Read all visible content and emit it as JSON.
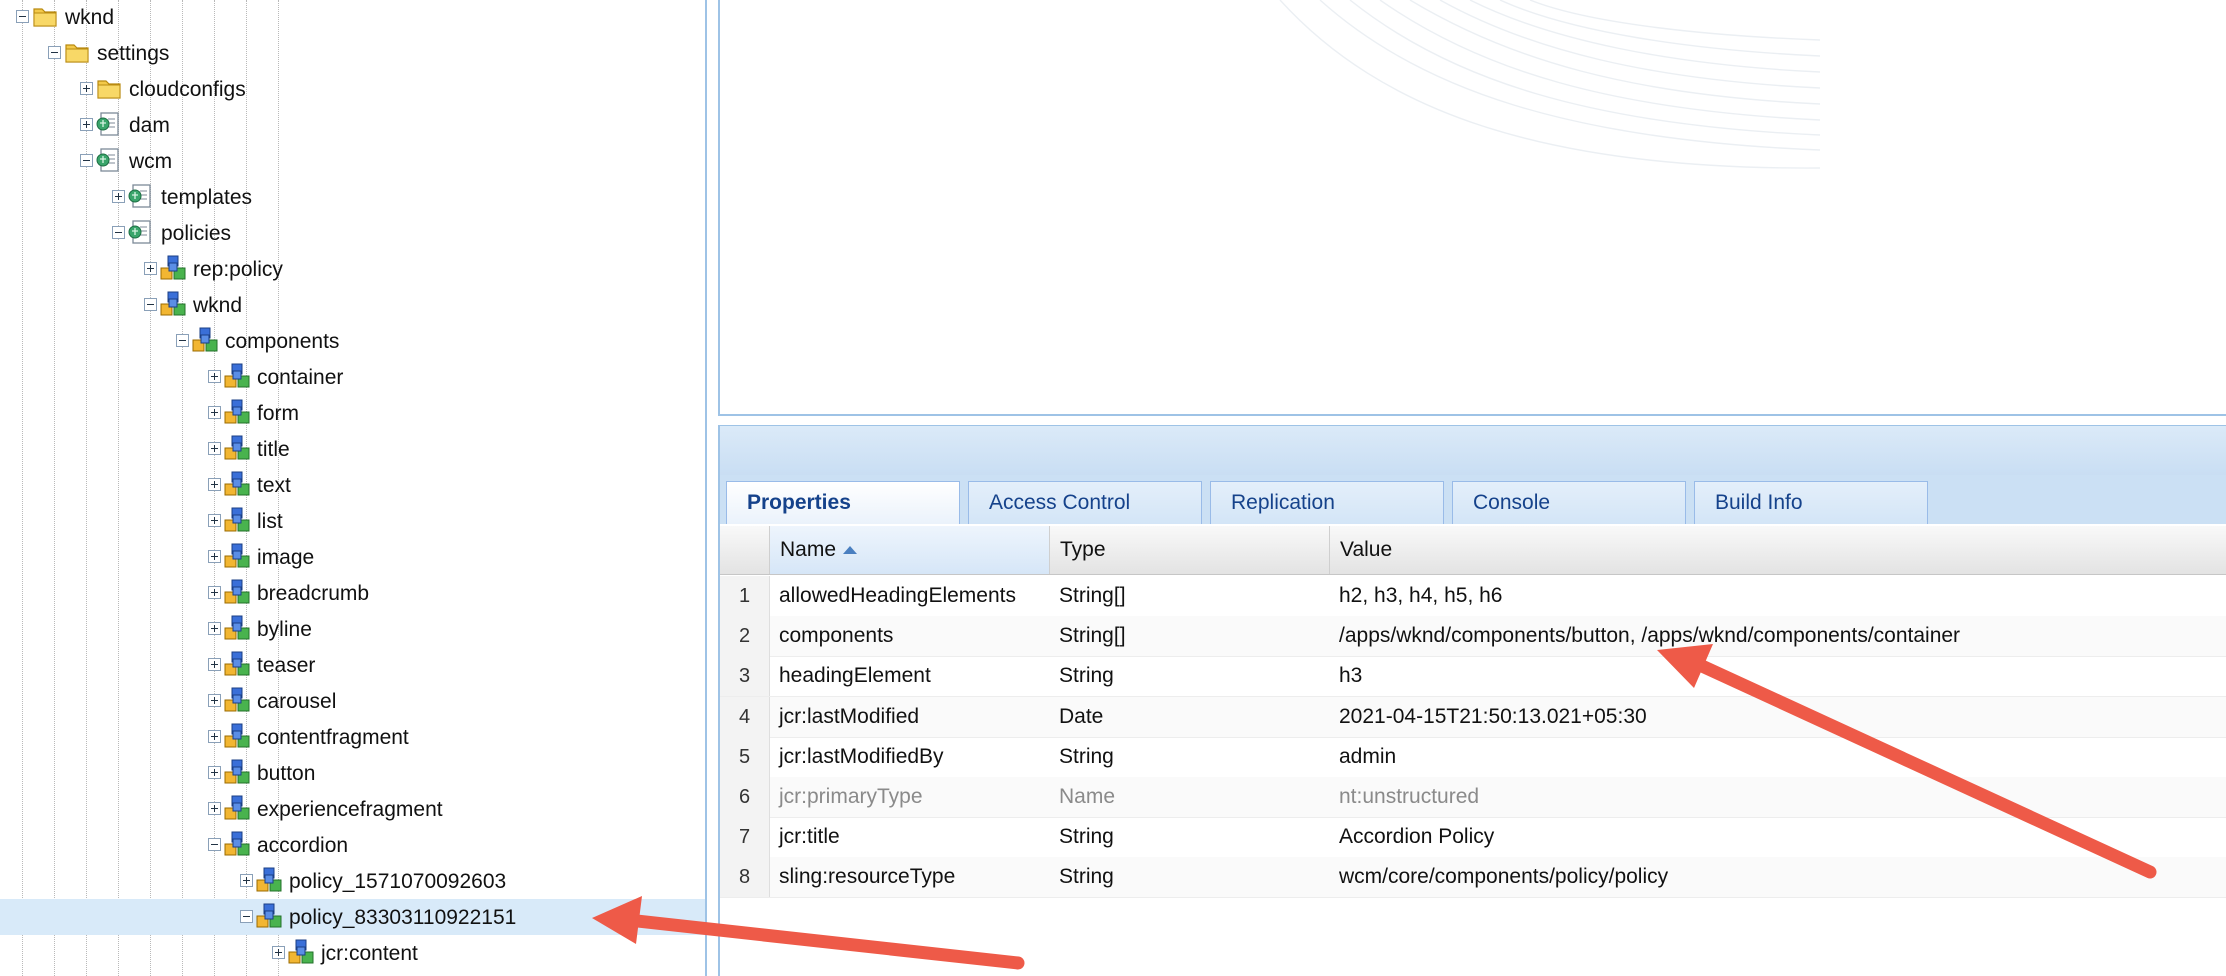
{
  "tree": {
    "nodes": [
      {
        "label": "wknd",
        "icon": "folder-icon",
        "level": 0,
        "expanded": true
      },
      {
        "label": "settings",
        "icon": "folder-icon",
        "level": 1,
        "expanded": true
      },
      {
        "label": "cloudconfigs",
        "icon": "folder-icon",
        "level": 2,
        "expanded": false
      },
      {
        "label": "dam",
        "icon": "page-icon",
        "level": 2,
        "expanded": false
      },
      {
        "label": "wcm",
        "icon": "page-icon",
        "level": 2,
        "expanded": true
      },
      {
        "label": "templates",
        "icon": "page-icon",
        "level": 3,
        "expanded": false
      },
      {
        "label": "policies",
        "icon": "page-icon",
        "level": 3,
        "expanded": true
      },
      {
        "label": "rep:policy",
        "icon": "node-icon",
        "level": 4,
        "expanded": false
      },
      {
        "label": "wknd",
        "icon": "node-icon",
        "level": 4,
        "expanded": true
      },
      {
        "label": "components",
        "icon": "node-icon",
        "level": 5,
        "expanded": true
      },
      {
        "label": "container",
        "icon": "node-icon",
        "level": 6,
        "expanded": false
      },
      {
        "label": "form",
        "icon": "node-icon",
        "level": 6,
        "expanded": false
      },
      {
        "label": "title",
        "icon": "node-icon",
        "level": 6,
        "expanded": false
      },
      {
        "label": "text",
        "icon": "node-icon",
        "level": 6,
        "expanded": false
      },
      {
        "label": "list",
        "icon": "node-icon",
        "level": 6,
        "expanded": false
      },
      {
        "label": "image",
        "icon": "node-icon",
        "level": 6,
        "expanded": false
      },
      {
        "label": "breadcrumb",
        "icon": "node-icon",
        "level": 6,
        "expanded": false
      },
      {
        "label": "byline",
        "icon": "node-icon",
        "level": 6,
        "expanded": false
      },
      {
        "label": "teaser",
        "icon": "node-icon",
        "level": 6,
        "expanded": false
      },
      {
        "label": "carousel",
        "icon": "node-icon",
        "level": 6,
        "expanded": false
      },
      {
        "label": "contentfragment",
        "icon": "node-icon",
        "level": 6,
        "expanded": false
      },
      {
        "label": "button",
        "icon": "node-icon",
        "level": 6,
        "expanded": false
      },
      {
        "label": "experiencefragment",
        "icon": "node-icon",
        "level": 6,
        "expanded": false
      },
      {
        "label": "accordion",
        "icon": "node-icon",
        "level": 6,
        "expanded": true
      },
      {
        "label": "policy_1571070092603",
        "icon": "node-icon",
        "level": 7,
        "expanded": false
      },
      {
        "label": "policy_83303110922151",
        "icon": "node-icon",
        "level": 7,
        "expanded": true,
        "selected": true
      },
      {
        "label": "jcr:content",
        "icon": "node-icon",
        "level": 8,
        "expanded": false
      }
    ]
  },
  "tabs": [
    {
      "label": "Properties",
      "active": true
    },
    {
      "label": "Access Control"
    },
    {
      "label": "Replication"
    },
    {
      "label": "Console"
    },
    {
      "label": "Build Info"
    }
  ],
  "grid": {
    "columns": {
      "name": "Name",
      "type": "Type",
      "value": "Value"
    },
    "rows": [
      {
        "num": "1",
        "name": "allowedHeadingElements",
        "type": "String[]",
        "value": "h2, h3, h4, h5, h6"
      },
      {
        "num": "2",
        "name": "components",
        "type": "String[]",
        "value": "/apps/wknd/components/button, /apps/wknd/components/container"
      },
      {
        "num": "3",
        "name": "headingElement",
        "type": "String",
        "value": "h3"
      },
      {
        "num": "4",
        "name": "jcr:lastModified",
        "type": "Date",
        "value": "2021-04-15T21:50:13.021+05:30"
      },
      {
        "num": "5",
        "name": "jcr:lastModifiedBy",
        "type": "String",
        "value": "admin"
      },
      {
        "num": "6",
        "name": "jcr:primaryType",
        "type": "Name",
        "value": "nt:unstructured",
        "muted": true
      },
      {
        "num": "7",
        "name": "jcr:title",
        "type": "String",
        "value": "Accordion Policy"
      },
      {
        "num": "8",
        "name": "sling:resourceType",
        "type": "String",
        "value": "wcm/core/components/policy/policy"
      }
    ]
  },
  "colors": {
    "accent": "#15428b",
    "selection": "#d8eaf9",
    "annotation": "#ee5a48",
    "panel_border": "#9ec3e6"
  }
}
